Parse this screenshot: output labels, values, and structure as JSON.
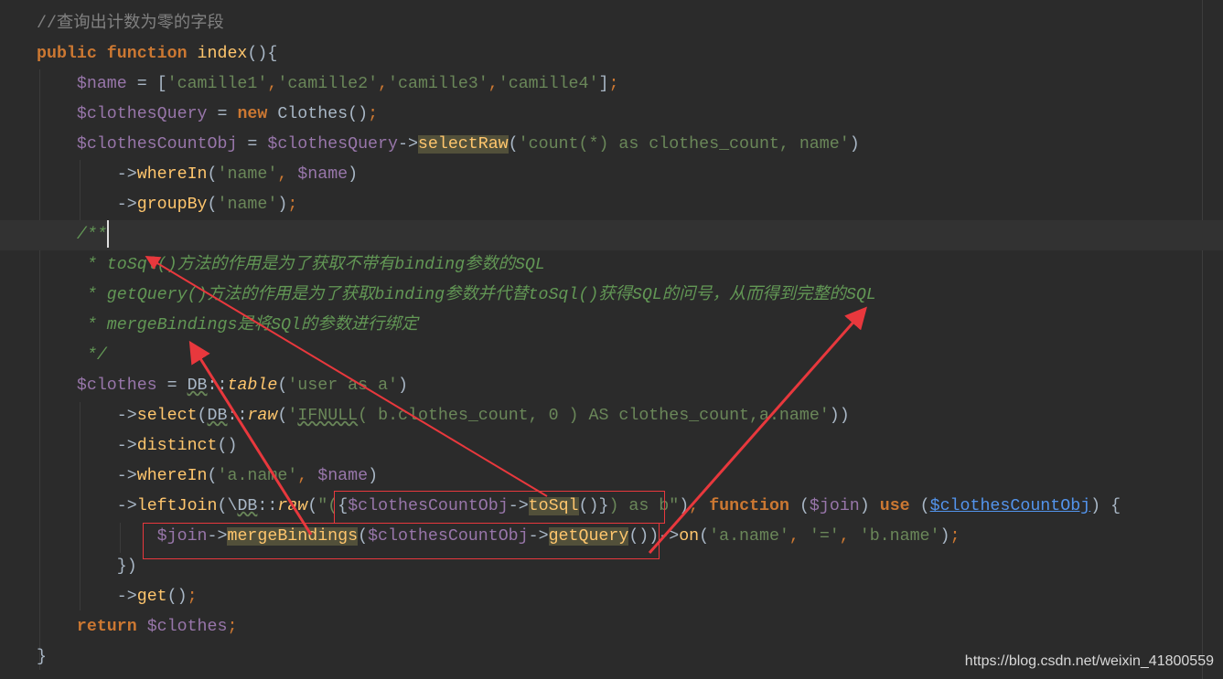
{
  "editor": {
    "lines": [
      [
        {
          "t": "//查询出计数为零的字段",
          "c": "cm"
        }
      ],
      [
        {
          "t": "public ",
          "c": "kw"
        },
        {
          "t": "function ",
          "c": "kw"
        },
        {
          "t": "index",
          "c": "fn"
        },
        {
          "t": "(){",
          "c": "cls"
        }
      ],
      [
        {
          "t": "    "
        },
        {
          "t": "$name",
          "c": "var"
        },
        {
          "t": " = [",
          "c": "cls"
        },
        {
          "t": "'camille1'",
          "c": "str"
        },
        {
          "t": ",",
          "c": "punc"
        },
        {
          "t": "'camille2'",
          "c": "str"
        },
        {
          "t": ",",
          "c": "punc"
        },
        {
          "t": "'camille3'",
          "c": "str"
        },
        {
          "t": ",",
          "c": "punc"
        },
        {
          "t": "'camille4'",
          "c": "str"
        },
        {
          "t": "]",
          "c": "cls"
        },
        {
          "t": ";",
          "c": "punc"
        }
      ],
      [
        {
          "t": "    "
        },
        {
          "t": "$clothesQuery",
          "c": "var"
        },
        {
          "t": " = ",
          "c": "cls"
        },
        {
          "t": "new ",
          "c": "kw"
        },
        {
          "t": "Clothes()",
          "c": "cls"
        },
        {
          "t": ";",
          "c": "punc"
        }
      ],
      [
        {
          "t": "    "
        },
        {
          "t": "$clothesCountObj",
          "c": "var"
        },
        {
          "t": " = ",
          "c": "cls"
        },
        {
          "t": "$clothesQuery",
          "c": "var"
        },
        {
          "t": "->",
          "c": "cls"
        },
        {
          "t": "selectRaw",
          "c": "fn hl"
        },
        {
          "t": "(",
          "c": "cls"
        },
        {
          "t": "'count(*) as clothes_count, name'",
          "c": "str"
        },
        {
          "t": ")",
          "c": "cls"
        }
      ],
      [
        {
          "t": "        "
        },
        {
          "t": "->",
          "c": "cls"
        },
        {
          "t": "whereIn",
          "c": "fn"
        },
        {
          "t": "(",
          "c": "cls"
        },
        {
          "t": "'name'",
          "c": "str"
        },
        {
          "t": ", ",
          "c": "punc"
        },
        {
          "t": "$name",
          "c": "var"
        },
        {
          "t": ")",
          "c": "cls"
        }
      ],
      [
        {
          "t": "        "
        },
        {
          "t": "->",
          "c": "cls"
        },
        {
          "t": "groupBy",
          "c": "fn"
        },
        {
          "t": "(",
          "c": "cls"
        },
        {
          "t": "'name'",
          "c": "str"
        },
        {
          "t": ")",
          "c": "cls"
        },
        {
          "t": ";",
          "c": "punc"
        }
      ],
      [
        {
          "t": "    "
        },
        {
          "t": "/**",
          "c": "doc"
        }
      ],
      [
        {
          "t": "     "
        },
        {
          "t": "* toSql()方法的作用是为了获取不带有binding参数的SQL",
          "c": "doc"
        }
      ],
      [
        {
          "t": "     "
        },
        {
          "t": "* getQuery()方法的作用是为了获取binding参数并代替toSql()获得SQL的问号，从而得到完整的SQL",
          "c": "doc"
        }
      ],
      [
        {
          "t": "     "
        },
        {
          "t": "* mergeBindings是将SQl的参数进行绑定",
          "c": "doc"
        }
      ],
      [
        {
          "t": "    "
        },
        {
          "t": " */",
          "c": "doc"
        }
      ],
      [
        {
          "t": "    "
        },
        {
          "t": "$clothes",
          "c": "var"
        },
        {
          "t": " = ",
          "c": "cls"
        },
        {
          "t": "DB",
          "c": "cls wavy"
        },
        {
          "t": "::",
          "c": "cls"
        },
        {
          "t": "table",
          "c": "it"
        },
        {
          "t": "(",
          "c": "cls"
        },
        {
          "t": "'user as a'",
          "c": "str"
        },
        {
          "t": ")",
          "c": "cls"
        }
      ],
      [
        {
          "t": "        "
        },
        {
          "t": "->",
          "c": "cls"
        },
        {
          "t": "select",
          "c": "fn"
        },
        {
          "t": "(",
          "c": "cls"
        },
        {
          "t": "DB",
          "c": "cls wavy"
        },
        {
          "t": "::",
          "c": "cls"
        },
        {
          "t": "raw",
          "c": "it"
        },
        {
          "t": "(",
          "c": "cls"
        },
        {
          "t": "'",
          "c": "str"
        },
        {
          "t": "IFNULL",
          "c": "str wavy"
        },
        {
          "t": "( b.clothes_count, 0 ) AS clothes_count,a.name'",
          "c": "str"
        },
        {
          "t": "))",
          "c": "cls"
        }
      ],
      [
        {
          "t": "        "
        },
        {
          "t": "->",
          "c": "cls"
        },
        {
          "t": "distinct",
          "c": "fn"
        },
        {
          "t": "()",
          "c": "cls"
        }
      ],
      [
        {
          "t": "        "
        },
        {
          "t": "->",
          "c": "cls"
        },
        {
          "t": "whereIn",
          "c": "fn"
        },
        {
          "t": "(",
          "c": "cls"
        },
        {
          "t": "'a.name'",
          "c": "str"
        },
        {
          "t": ", ",
          "c": "punc"
        },
        {
          "t": "$name",
          "c": "var"
        },
        {
          "t": ")",
          "c": "cls"
        }
      ],
      [
        {
          "t": "        "
        },
        {
          "t": "->",
          "c": "cls"
        },
        {
          "t": "leftJoin",
          "c": "fn"
        },
        {
          "t": "(\\",
          "c": "cls"
        },
        {
          "t": "DB",
          "c": "cls wavy"
        },
        {
          "t": "::",
          "c": "cls"
        },
        {
          "t": "raw",
          "c": "it"
        },
        {
          "t": "(",
          "c": "cls"
        },
        {
          "t": "\"(",
          "c": "str"
        },
        {
          "t": "{",
          "c": "cls"
        },
        {
          "t": "$clothesCountObj",
          "c": "var"
        },
        {
          "t": "->",
          "c": "cls"
        },
        {
          "t": "toSql",
          "c": "fn hl"
        },
        {
          "t": "()}",
          "c": "cls"
        },
        {
          "t": ") as b\"",
          "c": "str"
        },
        {
          "t": ")",
          "c": "cls"
        },
        {
          "t": ", ",
          "c": "punc"
        },
        {
          "t": "function ",
          "c": "kw"
        },
        {
          "t": "(",
          "c": "cls"
        },
        {
          "t": "$join",
          "c": "var"
        },
        {
          "t": ") ",
          "c": "cls"
        },
        {
          "t": "use ",
          "c": "kw"
        },
        {
          "t": "(",
          "c": "cls"
        },
        {
          "t": "$clothesCountObj",
          "c": "link"
        },
        {
          "t": ") {",
          "c": "cls"
        }
      ],
      [
        {
          "t": "            "
        },
        {
          "t": "$join",
          "c": "var"
        },
        {
          "t": "->",
          "c": "cls"
        },
        {
          "t": "mergeBindings",
          "c": "fn hl"
        },
        {
          "t": "(",
          "c": "cls"
        },
        {
          "t": "$clothesCountObj",
          "c": "var"
        },
        {
          "t": "->",
          "c": "cls"
        },
        {
          "t": "getQuery",
          "c": "fn hl"
        },
        {
          "t": "())",
          "c": "cls"
        },
        {
          "t": "->",
          "c": "cls"
        },
        {
          "t": "on",
          "c": "fn"
        },
        {
          "t": "(",
          "c": "cls"
        },
        {
          "t": "'a.name'",
          "c": "str"
        },
        {
          "t": ", ",
          "c": "punc"
        },
        {
          "t": "'='",
          "c": "str"
        },
        {
          "t": ", ",
          "c": "punc"
        },
        {
          "t": "'b.name'",
          "c": "str"
        },
        {
          "t": ")",
          "c": "cls"
        },
        {
          "t": ";",
          "c": "punc"
        }
      ],
      [
        {
          "t": "        "
        },
        {
          "t": "})",
          "c": "cls"
        }
      ],
      [
        {
          "t": "        "
        },
        {
          "t": "->",
          "c": "cls"
        },
        {
          "t": "get",
          "c": "fn"
        },
        {
          "t": "()",
          "c": "cls"
        },
        {
          "t": ";",
          "c": "punc"
        }
      ],
      [
        {
          "t": "    "
        },
        {
          "t": "return ",
          "c": "kw"
        },
        {
          "t": "$clothes",
          "c": "var"
        },
        {
          "t": ";",
          "c": "punc"
        }
      ],
      [
        {
          "t": "}",
          "c": "cls"
        }
      ]
    ],
    "current_line": 7
  },
  "annotation_color": "#e8383d",
  "watermark": "https://blog.csdn.net/weixin_41800559"
}
